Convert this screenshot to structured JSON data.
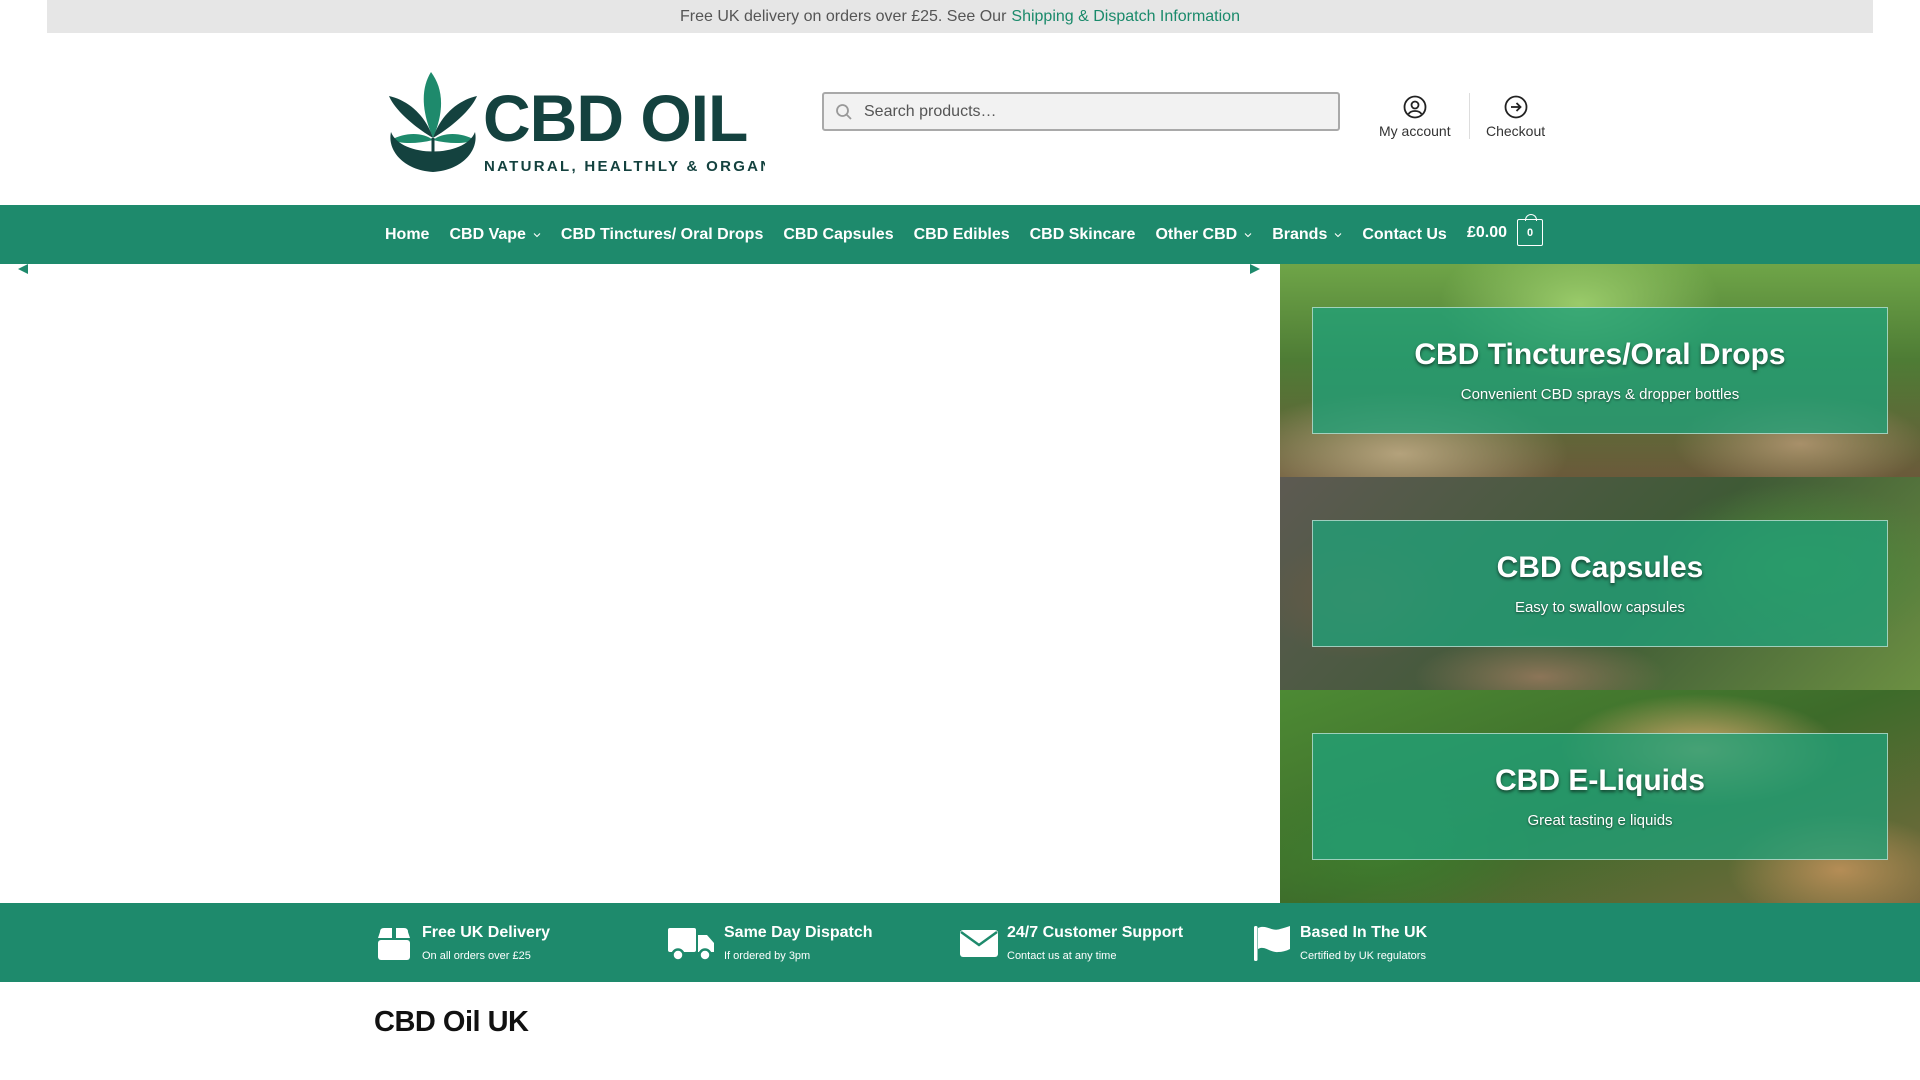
{
  "topbar": {
    "text": "Free UK delivery on orders over £25. See Our",
    "link": "Shipping & Dispatch Information"
  },
  "logo": {
    "wordmark": "CBD OIL",
    "tagline": "NATURAL, HEALTHLY & ORGANIC",
    "icon": "cannabis-leaf-icon"
  },
  "search": {
    "placeholder": "Search products…",
    "icon": "search-icon"
  },
  "header_links": [
    {
      "label": "My account",
      "icon": "user-circle-icon"
    },
    {
      "label": "Checkout",
      "icon": "arrow-circle-icon"
    }
  ],
  "nav": {
    "items": [
      {
        "label": "Home"
      },
      {
        "label": "CBD Vape"
      },
      {
        "label": "CBD Tinctures/ Oral Drops"
      },
      {
        "label": "CBD Capsules"
      },
      {
        "label": "CBD Edibles"
      },
      {
        "label": "CBD Skincare"
      },
      {
        "label": "Other CBD"
      },
      {
        "label": "Brands"
      },
      {
        "label": "Contact Us"
      }
    ],
    "cart_total": "£0.00",
    "cart_count": "0"
  },
  "panels": [
    {
      "title": "CBD Tinctures/Oral Drops",
      "subtitle": "Convenient CBD sprays & dropper bottles"
    },
    {
      "title": "CBD Capsules",
      "subtitle": "Easy to swallow capsules"
    },
    {
      "title": "CBD E-Liquids",
      "subtitle": "Great tasting e liquids"
    }
  ],
  "features": [
    {
      "title": "Free UK Delivery",
      "subtitle": "On all orders over £25",
      "icon": "box-icon"
    },
    {
      "title": "Same Day Dispatch",
      "subtitle": "If ordered by 3pm",
      "icon": "truck-icon"
    },
    {
      "title": "24/7 Customer Support",
      "subtitle": "Contact us at any time",
      "icon": "envelope-icon"
    },
    {
      "title": "Based In The UK",
      "subtitle": "Certified by UK regulators",
      "icon": "flag-icon"
    }
  ],
  "page_title": "CBD Oil UK",
  "colors": {
    "brand_green": "#1e8a6c",
    "logo_dark": "#14423f",
    "link": "#1a8a6b"
  }
}
